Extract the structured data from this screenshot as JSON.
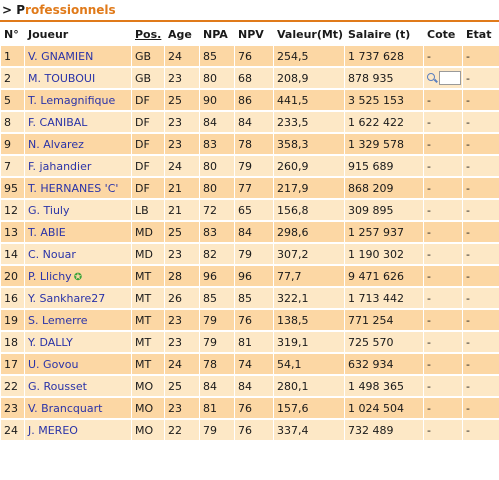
{
  "section": {
    "arrow": ">",
    "first_letter": "P",
    "rest": "rofessionnels"
  },
  "columns": [
    "N°",
    "Joueur",
    "Pos.",
    "Age",
    "NPA",
    "NPV",
    "Valeur(Mt)",
    "Salaire (t)",
    "Cote",
    "Etat"
  ],
  "players": [
    {
      "num": "1",
      "name": "V. GNAMIEN",
      "pos": "GB",
      "age": "24",
      "npa": "85",
      "npv": "76",
      "valeur": "254,5",
      "salaire": "1 737 628",
      "cote": "-",
      "etat": "-"
    },
    {
      "num": "2",
      "name": "M. TOUBOUI",
      "pos": "GB",
      "age": "23",
      "npa": "80",
      "npv": "68",
      "valeur": "208,9",
      "salaire": "878 935",
      "cote": "",
      "etat": "-"
    },
    {
      "num": "5",
      "name": "T. Lemagnifique",
      "pos": "DF",
      "age": "25",
      "npa": "90",
      "npv": "86",
      "valeur": "441,5",
      "salaire": "3 525 153",
      "cote": "-",
      "etat": "-"
    },
    {
      "num": "8",
      "name": "F. CANIBAL",
      "pos": "DF",
      "age": "23",
      "npa": "84",
      "npv": "84",
      "valeur": "233,5",
      "salaire": "1 622 422",
      "cote": "-",
      "etat": "-"
    },
    {
      "num": "9",
      "name": "N. Alvarez",
      "pos": "DF",
      "age": "23",
      "npa": "83",
      "npv": "78",
      "valeur": "358,3",
      "salaire": "1 329 578",
      "cote": "-",
      "etat": "-"
    },
    {
      "num": "7",
      "name": "F. jahandier",
      "pos": "DF",
      "age": "24",
      "npa": "80",
      "npv": "79",
      "valeur": "260,9",
      "salaire": "915 689",
      "cote": "-",
      "etat": "-"
    },
    {
      "num": "95",
      "name": "T. HERNANES 'C'",
      "pos": "DF",
      "age": "21",
      "npa": "80",
      "npv": "77",
      "valeur": "217,9",
      "salaire": "868 209",
      "cote": "-",
      "etat": "-"
    },
    {
      "num": "12",
      "name": "G. Tiuly",
      "pos": "LB",
      "age": "21",
      "npa": "72",
      "npv": "65",
      "valeur": "156,8",
      "salaire": "309 895",
      "cote": "-",
      "etat": "-"
    },
    {
      "num": "13",
      "name": "T. ABIE",
      "pos": "MD",
      "age": "25",
      "npa": "83",
      "npv": "84",
      "valeur": "298,6",
      "salaire": "1 257 937",
      "cote": "-",
      "etat": "-"
    },
    {
      "num": "14",
      "name": "C. Nouar",
      "pos": "MD",
      "age": "23",
      "npa": "82",
      "npv": "79",
      "valeur": "307,2",
      "salaire": "1 190 302",
      "cote": "-",
      "etat": "-"
    },
    {
      "num": "20",
      "name": "P. Llichy",
      "pos": "MT",
      "age": "28",
      "npa": "96",
      "npv": "96",
      "valeur": "77,7",
      "salaire": "9 471 626",
      "cote": "-",
      "etat": "-"
    },
    {
      "num": "16",
      "name": "Y. Sankhare27",
      "pos": "MT",
      "age": "26",
      "npa": "85",
      "npv": "85",
      "valeur": "322,1",
      "salaire": "1 713 442",
      "cote": "-",
      "etat": "-"
    },
    {
      "num": "19",
      "name": "S. Lemerre",
      "pos": "MT",
      "age": "23",
      "npa": "79",
      "npv": "76",
      "valeur": "138,5",
      "salaire": "771 254",
      "cote": "-",
      "etat": "-"
    },
    {
      "num": "18",
      "name": "Y. DALLY",
      "pos": "MT",
      "age": "23",
      "npa": "79",
      "npv": "81",
      "valeur": "319,1",
      "salaire": "725 570",
      "cote": "-",
      "etat": "-"
    },
    {
      "num": "17",
      "name": "U. Govou",
      "pos": "MT",
      "age": "24",
      "npa": "78",
      "npv": "74",
      "valeur": "54,1",
      "salaire": "632 934",
      "cote": "-",
      "etat": "-"
    },
    {
      "num": "22",
      "name": "G. Rousset",
      "pos": "MO",
      "age": "25",
      "npa": "84",
      "npv": "84",
      "valeur": "280,1",
      "salaire": "1 498 365",
      "cote": "-",
      "etat": "-"
    },
    {
      "num": "23",
      "name": "V. Brancquart",
      "pos": "MO",
      "age": "23",
      "npa": "81",
      "npv": "76",
      "valeur": "157,6",
      "salaire": "1 024 504",
      "cote": "-",
      "etat": "-"
    },
    {
      "num": "24",
      "name": "J. MEREO",
      "pos": "MO",
      "age": "22",
      "npa": "79",
      "npv": "76",
      "valeur": "337,4",
      "salaire": "732 489",
      "cote": "-",
      "etat": "-"
    }
  ],
  "colors": {
    "row_odd": "#fcd7a4",
    "row_even": "#fde8c6",
    "link": "#2a33a8",
    "accent": "#e07a1a"
  }
}
